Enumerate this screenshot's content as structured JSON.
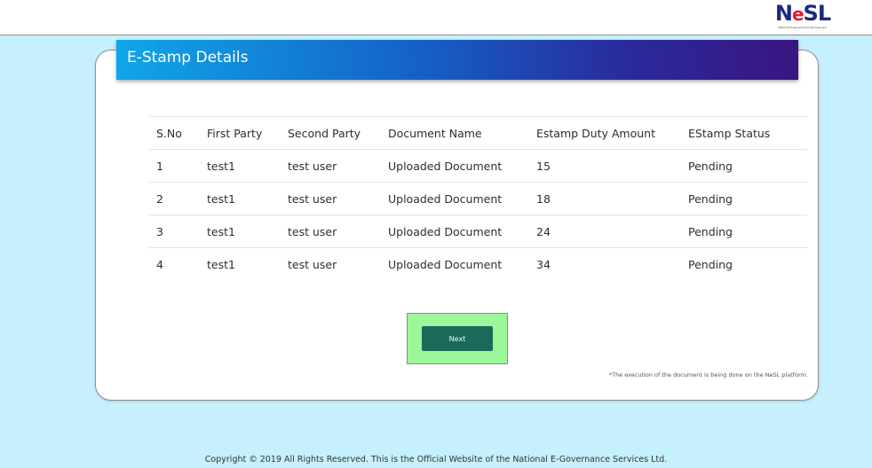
{
  "logo": {
    "text_n": "N",
    "text_e": "e",
    "text_sl": "SL",
    "subtitle": "National E-Governance Services Ltd."
  },
  "card": {
    "title": "E-Stamp Details"
  },
  "table": {
    "headers": [
      "S.No",
      "First Party",
      "Second Party",
      "Document Name",
      "Estamp Duty Amount",
      "EStamp Status"
    ],
    "rows": [
      [
        "1",
        "test1",
        "test user",
        "Uploaded Document",
        "15",
        "Pending"
      ],
      [
        "2",
        "test1",
        "test user",
        "Uploaded Document",
        "18",
        "Pending"
      ],
      [
        "3",
        "test1",
        "test user",
        "Uploaded Document",
        "24",
        "Pending"
      ],
      [
        "4",
        "test1",
        "test user",
        "Uploaded Document",
        "34",
        "Pending"
      ]
    ]
  },
  "next_button": {
    "label": "Next"
  },
  "note": {
    "star": "*",
    "text": "The execution of the document is being done on the NeSL platform."
  },
  "footer": {
    "text": "Copyright © 2019 All Rights Reserved. This is the Official Website of the National E-Governance Services Ltd."
  },
  "colors": {
    "background": "#c6f0fe",
    "header_gradient_start": "#0fa6e9",
    "header_gradient_end": "#3a1580",
    "button": "#1a6a5a",
    "highlight": "#9cf79a"
  }
}
